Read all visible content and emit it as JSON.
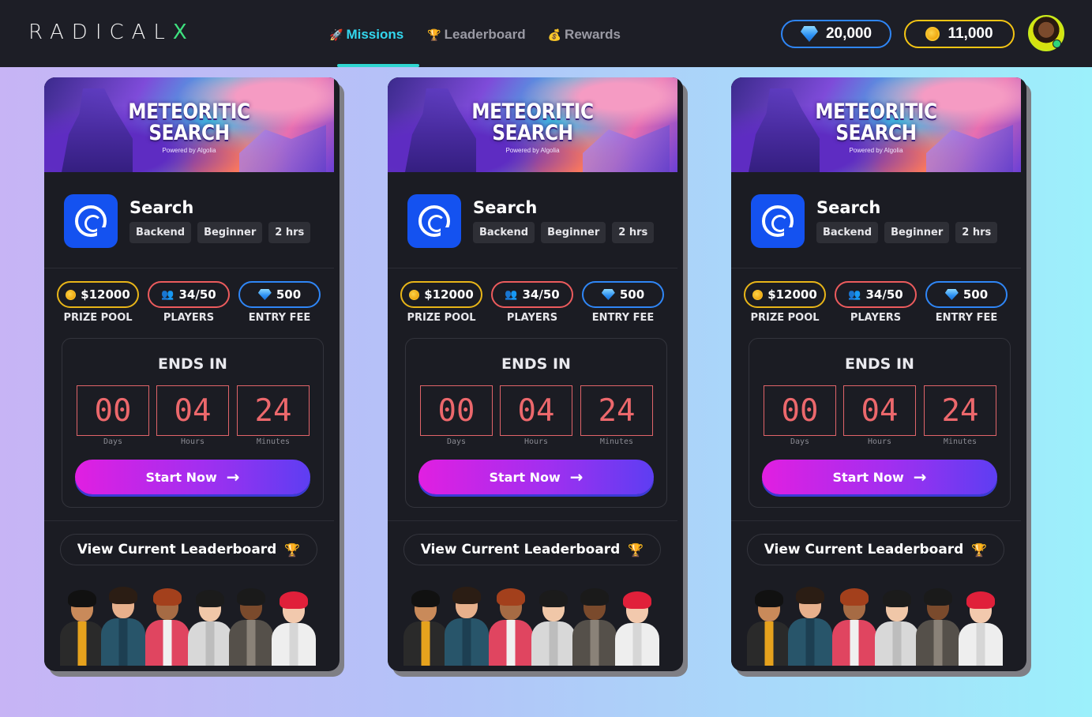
{
  "brand": {
    "logo_text": "RADICAL",
    "logo_accent": "X"
  },
  "nav": [
    {
      "icon": "rocket-icon",
      "glyph": "🚀",
      "label": "Missions",
      "active": true
    },
    {
      "icon": "trophy-icon",
      "glyph": "🏆",
      "label": "Leaderboard",
      "active": false
    },
    {
      "icon": "money-bag-icon",
      "glyph": "💰",
      "label": "Rewards",
      "active": false
    }
  ],
  "wallet": {
    "gems": "20,000",
    "coins": "11,000"
  },
  "colors": {
    "accent_teal": "#33d7ee",
    "gem_blue": "#2f86f6",
    "coin_gold": "#f4c514",
    "players_red": "#ec5b5d",
    "timer_red": "#ec686c"
  },
  "cards": [
    {
      "banner_title_1": "METEORITIC",
      "banner_title_2": "SEARCH",
      "banner_powered": "Powered by Algolia",
      "title": "Search",
      "tags": [
        "Backend",
        "Beginner",
        "2 hrs"
      ],
      "prize": "$12000",
      "prize_label": "PRIZE POOL",
      "players": "34/50",
      "players_label": "PLAYERS",
      "fee": "500",
      "fee_label": "ENTRY FEE",
      "ends_in": "ENDS IN",
      "days": "00",
      "days_label": "Days",
      "hours": "04",
      "hours_label": "Hours",
      "minutes": "24",
      "minutes_label": "Minutes",
      "start_label": "Start Now",
      "leaderboard_label": "View Current Leaderboard"
    },
    {
      "banner_title_1": "METEORITIC",
      "banner_title_2": "SEARCH",
      "banner_powered": "Powered by Algolia",
      "title": "Search",
      "tags": [
        "Backend",
        "Beginner",
        "2 hrs"
      ],
      "prize": "$12000",
      "prize_label": "PRIZE POOL",
      "players": "34/50",
      "players_label": "PLAYERS",
      "fee": "500",
      "fee_label": "ENTRY FEE",
      "ends_in": "ENDS IN",
      "days": "00",
      "days_label": "Days",
      "hours": "04",
      "hours_label": "Hours",
      "minutes": "24",
      "minutes_label": "Minutes",
      "start_label": "Start Now",
      "leaderboard_label": "View Current Leaderboard"
    },
    {
      "banner_title_1": "METEORITIC",
      "banner_title_2": "SEARCH",
      "banner_powered": "Powered by Algolia",
      "title": "Search",
      "tags": [
        "Backend",
        "Beginner",
        "2 hrs"
      ],
      "prize": "$12000",
      "prize_label": "PRIZE POOL",
      "players": "34/50",
      "players_label": "PLAYERS",
      "fee": "500",
      "fee_label": "ENTRY FEE",
      "ends_in": "ENDS IN",
      "days": "00",
      "days_label": "Days",
      "hours": "04",
      "hours_label": "Hours",
      "minutes": "24",
      "minutes_label": "Minutes",
      "start_label": "Start Now",
      "leaderboard_label": "View Current Leaderboard"
    }
  ]
}
